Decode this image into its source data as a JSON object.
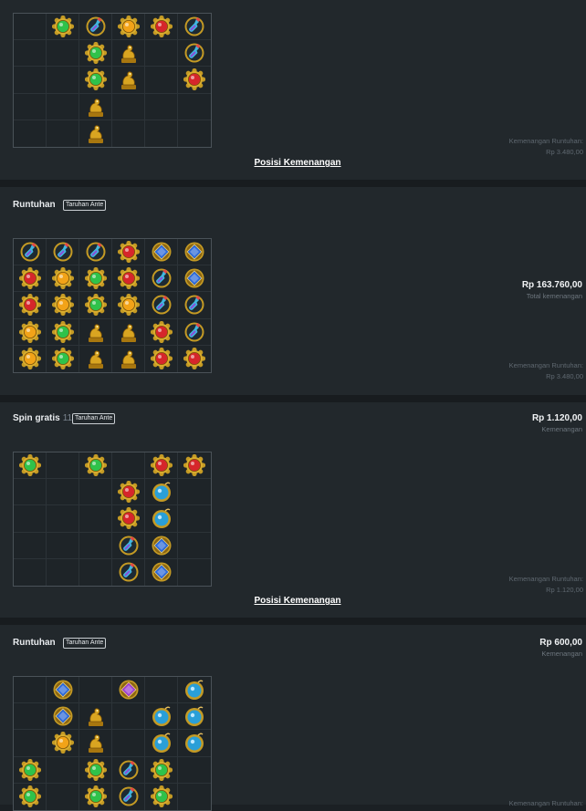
{
  "rounds": [
    {
      "grid": [
        [
          "",
          "green",
          "bottle",
          "amber",
          "red",
          "bottle"
        ],
        [
          "",
          "",
          "green",
          "idol",
          "",
          "bottle"
        ],
        [
          "",
          "",
          "green",
          "idol",
          "",
          "red"
        ],
        [
          "",
          "",
          "idol",
          "",
          "",
          ""
        ],
        [
          "",
          "",
          "idol",
          "",
          "",
          ""
        ]
      ],
      "cascade_label": "Kemenangan Runtuhan:",
      "cascade_value": "Rp 3.480,00",
      "win_positions_label": "Posisi Kemenangan"
    },
    {
      "title": "Runtuhan",
      "badge": "Taruhan Ante",
      "amount": "Rp 163.760,00",
      "amount_label": "Total kemenangan",
      "grid": [
        [
          "bottle",
          "bottle",
          "bottle",
          "red",
          "blue",
          "blue"
        ],
        [
          "red",
          "amber",
          "green",
          "red",
          "bottle",
          "blue"
        ],
        [
          "red",
          "amber",
          "green",
          "amber",
          "bottle",
          "bottle"
        ],
        [
          "amber",
          "green",
          "idol",
          "idol",
          "red",
          "bottle"
        ],
        [
          "amber",
          "green",
          "idol",
          "idol",
          "red",
          "red"
        ]
      ],
      "cascade_label": "Kemenangan Runtuhan:",
      "cascade_value": "Rp 3.480,00"
    },
    {
      "title": "Spin gratis",
      "count": "11",
      "badge": "Taruhan Ante",
      "amount": "Rp 1.120,00",
      "amount_label": "Kemenangan",
      "grid": [
        [
          "green",
          "",
          "green",
          "",
          "red",
          "red"
        ],
        [
          "",
          "",
          "",
          "red",
          "bomb",
          ""
        ],
        [
          "",
          "",
          "",
          "red",
          "bomb",
          ""
        ],
        [
          "",
          "",
          "",
          "bottle",
          "blue",
          ""
        ],
        [
          "",
          "",
          "",
          "bottle",
          "blue",
          ""
        ]
      ],
      "cascade_label": "Kemenangan Runtuhan:",
      "cascade_value": "Rp 1.120,00",
      "win_positions_label": "Posisi Kemenangan"
    },
    {
      "title": "Runtuhan",
      "badge": "Taruhan Ante",
      "amount": "Rp 600,00",
      "amount_label": "Kemenangan",
      "grid": [
        [
          "",
          "blue",
          "",
          "purple",
          "",
          "bomb"
        ],
        [
          "",
          "blue",
          "idol",
          "",
          "bomb",
          "bomb"
        ],
        [
          "",
          "amber",
          "idol",
          "",
          "bomb",
          "bomb"
        ],
        [
          "green",
          "",
          "green",
          "bottle",
          "green",
          ""
        ],
        [
          "green",
          "",
          "green",
          "bottle",
          "green",
          ""
        ]
      ],
      "cascade_label": "Kemenangan Runtuhan:"
    }
  ],
  "symbols": {
    "green": {
      "name": "green-gem-icon",
      "color": "#2fc24a"
    },
    "red": {
      "name": "red-gem-icon",
      "color": "#d6262b"
    },
    "amber": {
      "name": "amber-gem-icon",
      "color": "#f2a318"
    },
    "blue": {
      "name": "blue-gem-icon",
      "color": "#2a67d8"
    },
    "purple": {
      "name": "purple-gem-icon",
      "color": "#9b3fd0"
    },
    "bottle": {
      "name": "potion-bottle-icon",
      "color": "#3fb7e0"
    },
    "bomb": {
      "name": "blue-bomb-icon",
      "color": "#2a9fd8"
    },
    "idol": {
      "name": "golden-idol-icon",
      "color": "#d9a521"
    }
  }
}
